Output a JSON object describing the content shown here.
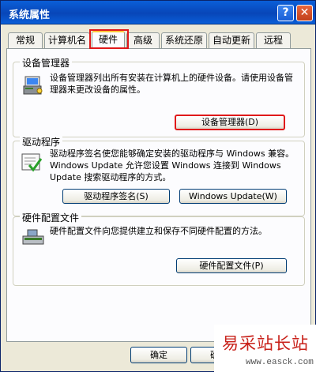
{
  "window": {
    "title": "系统属性"
  },
  "titlebar": {
    "help": "?",
    "close": "✕"
  },
  "tabs": [
    {
      "label": "常规"
    },
    {
      "label": "计算机名"
    },
    {
      "label": "硬件"
    },
    {
      "label": "高级"
    },
    {
      "label": "系统还原"
    },
    {
      "label": "自动更新"
    },
    {
      "label": "远程"
    }
  ],
  "groups": {
    "device_manager": {
      "title": "设备管理器",
      "description": "设备管理器列出所有安装在计算机上的硬件设备。请使用设备管理器来更改设备的属性。",
      "button": "设备管理器(D)",
      "icon": "device-manager-icon"
    },
    "drivers": {
      "title": "驱动程序",
      "description": "驱动程序签名使您能够确定安装的驱动程序与 Windows 兼容。Windows Update 允许您设置 Windows 连接到 Windows Update 搜索驱动程序的方式。",
      "button_signing": "驱动程序签名(S)",
      "button_update": "Windows Update(W)",
      "icon": "driver-signing-icon"
    },
    "hardware_profiles": {
      "title": "硬件配置文件",
      "description": "硬件配置文件向您提供建立和保存不同硬件配置的方法。",
      "button": "硬件配置文件(P)",
      "icon": "hardware-profile-icon"
    }
  },
  "footer": {
    "ok": "确定",
    "ok2": "确定"
  },
  "watermark": {
    "title": "易采站长站",
    "url": "www.easck.com"
  },
  "colors": {
    "highlight": "#e0191a",
    "titlebar": "#0a5fd8",
    "face": "#ece9d8"
  }
}
